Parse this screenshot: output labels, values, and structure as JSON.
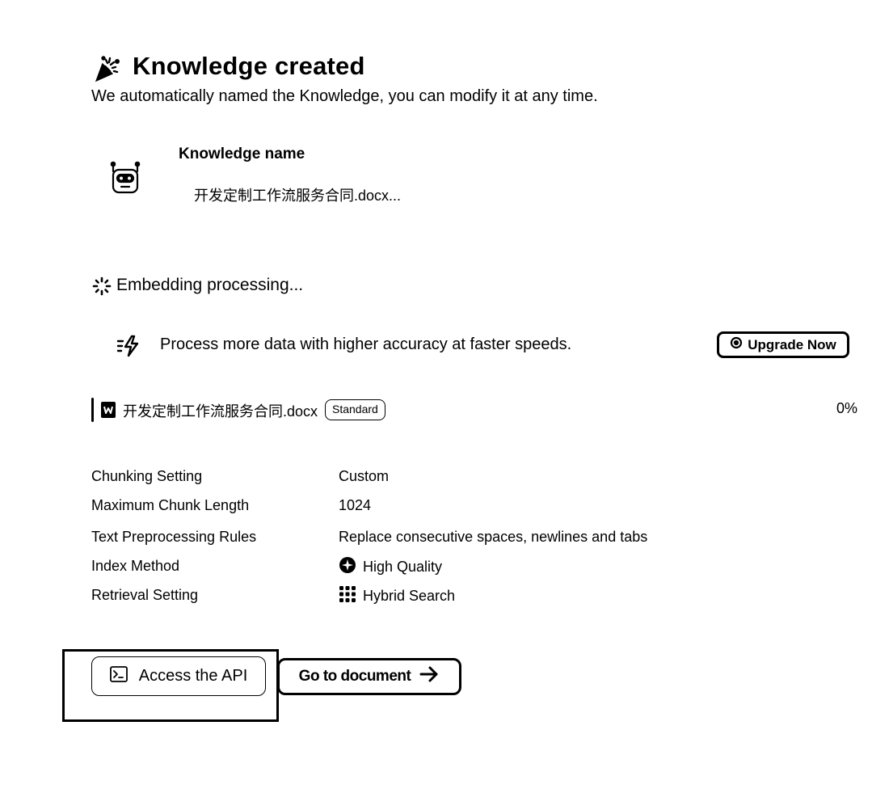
{
  "header": {
    "icon": "party-popper-icon",
    "title": "Knowledge created",
    "subtitle": "We automatically named the Knowledge, you can modify it at any time."
  },
  "knowledge": {
    "icon": "robot-icon",
    "name_label": "Knowledge name",
    "name_value": "开发定制工作流服务合同.docx..."
  },
  "embedding": {
    "icon": "spinner-icon",
    "status": "Embedding processing..."
  },
  "upgrade": {
    "icon": "lightning-icon",
    "text": "Process more data with higher accuracy at faster speeds.",
    "button_icon": "sparkle-icon",
    "button_label": "Upgrade Now"
  },
  "file": {
    "icon": "word-document-icon",
    "name": "开发定制工作流服务合同.docx",
    "badge": "Standard",
    "progress": "0%"
  },
  "settings": [
    {
      "label": "Chunking Setting",
      "value": "Custom",
      "icon": ""
    },
    {
      "label": "Maximum Chunk Length",
      "value": "1024",
      "icon": ""
    },
    {
      "label": "Text Preprocessing Rules",
      "value": "Replace consecutive spaces, newlines and tabs",
      "icon": ""
    },
    {
      "label": "Index Method",
      "value": "High Quality",
      "icon": "gear-badge-icon"
    },
    {
      "label": "Retrieval Setting",
      "value": "Hybrid Search",
      "icon": "grid-dots-icon"
    }
  ],
  "actions": {
    "api_icon": "terminal-icon",
    "api_label": "Access the API",
    "doc_label": "Go to document",
    "doc_icon": "arrow-right-icon"
  },
  "colors": {
    "foreground": "#000000",
    "background": "#ffffff"
  }
}
